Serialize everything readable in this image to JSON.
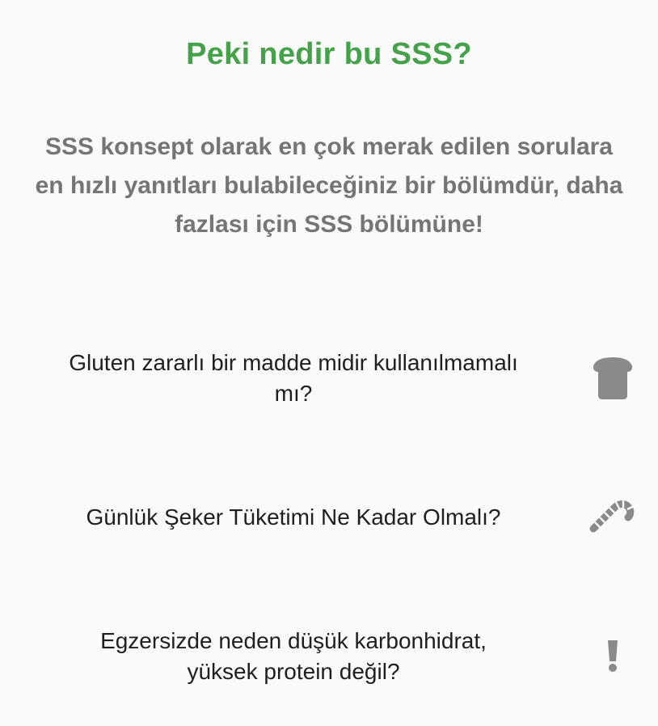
{
  "header": {
    "title": "Peki nedir bu SSS?",
    "intro_line1": "SSS konsept olarak en çok merak edilen sorulara",
    "intro_line2": "en hızlı yanıtları bulabileceğiniz bir bölümdür, daha",
    "intro_line3": "fazlası için SSS bölümüne!"
  },
  "colors": {
    "accent": "#46a24a",
    "intro_text": "#757575",
    "question_text": "#1f1f1f",
    "icon": "#8a8a8a",
    "background": "#fafafa"
  },
  "faq": {
    "items": [
      {
        "line1": "Gluten zararlı bir madde midir kullanılmamalı",
        "line2": "mı?",
        "icon": "bread-icon"
      },
      {
        "line1": "Günlük Şeker Tüketimi Ne Kadar Olmalı?",
        "line2": "",
        "icon": "candy-cane-icon"
      },
      {
        "line1": "Egzersizde neden düşük karbonhidrat,",
        "line2": "yüksek protein değil?",
        "icon": "exclamation-icon"
      }
    ]
  }
}
